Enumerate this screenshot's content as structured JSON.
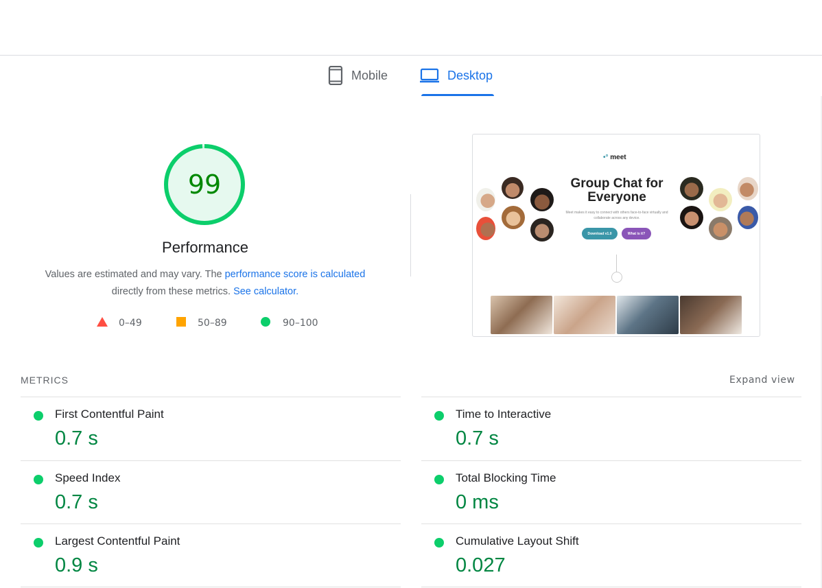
{
  "tabs": {
    "mobile_label": "Mobile",
    "desktop_label": "Desktop",
    "active": "Desktop"
  },
  "performance": {
    "score": "99",
    "title": "Performance",
    "desc_prefix": "Values are estimated and may vary. The ",
    "desc_link1": "performance score is calculated",
    "desc_middle": " directly from these metrics. ",
    "desc_link2": "See calculator."
  },
  "legend": {
    "fail": "0–49",
    "average": "50–89",
    "pass": "90–100"
  },
  "screenshot_preview": {
    "logo": "meet",
    "headline": "Group Chat for Everyone",
    "subtext": "Meet makes it easy to connect with others face-to-face virtually and collaborate across any device.",
    "button1": "Download v1.0",
    "button2": "What is it?"
  },
  "metrics": {
    "label": "METRICS",
    "expand": "Expand view",
    "items": [
      {
        "name": "First Contentful Paint",
        "value": "0.7 s"
      },
      {
        "name": "Time to Interactive",
        "value": "0.7 s"
      },
      {
        "name": "Speed Index",
        "value": "0.7 s"
      },
      {
        "name": "Total Blocking Time",
        "value": "0 ms"
      },
      {
        "name": "Largest Contentful Paint",
        "value": "0.9 s"
      },
      {
        "name": "Cumulative Layout Shift",
        "value": "0.027"
      }
    ]
  },
  "colors": {
    "pass": "#0cce6b",
    "pass_text": "#018642",
    "average": "#ffa400",
    "fail": "#ff4e42",
    "accent": "#1a73e8"
  }
}
